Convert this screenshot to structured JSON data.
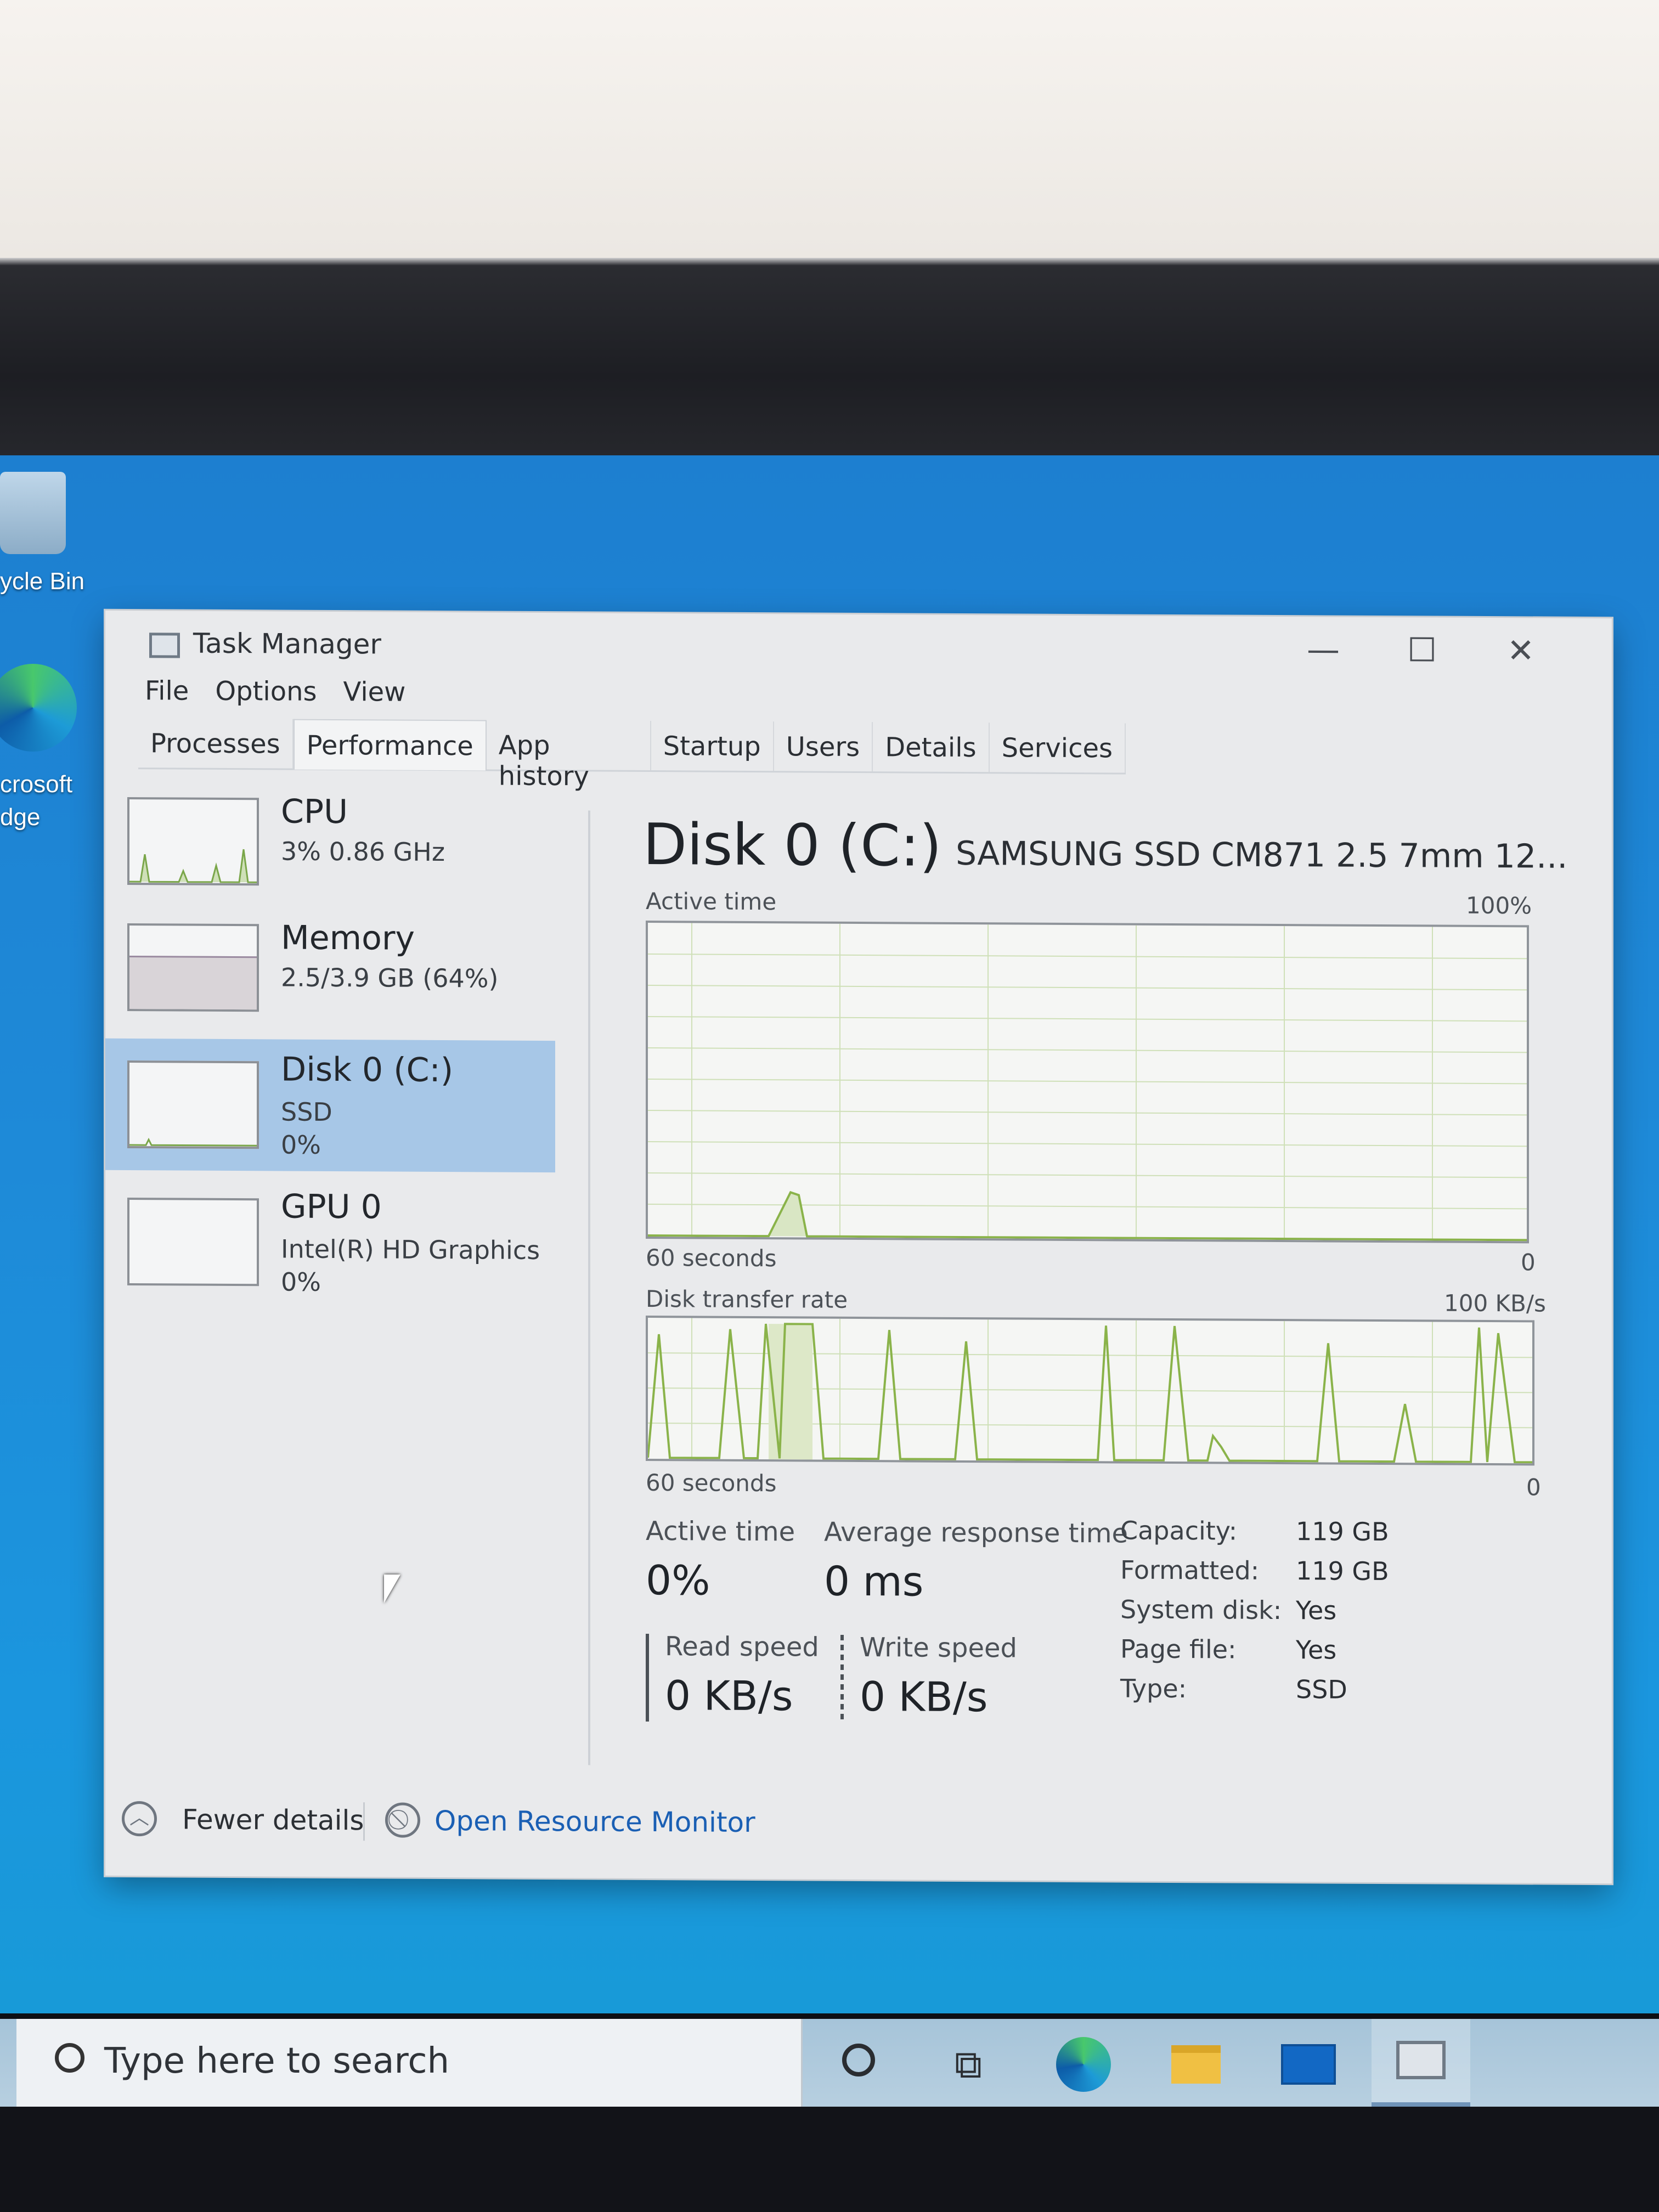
{
  "desktop": {
    "icons": [
      {
        "label": "ycle Bin"
      },
      {
        "label_line1": "crosoft",
        "label_line2": "dge"
      }
    ]
  },
  "window": {
    "title": "Task Manager",
    "controls": {
      "minimize": "—",
      "maximize": "☐",
      "close": "✕"
    }
  },
  "menu": [
    "File",
    "Options",
    "View"
  ],
  "tabs": [
    "Processes",
    "Performance",
    "App history",
    "Startup",
    "Users",
    "Details",
    "Services"
  ],
  "active_tab": "Performance",
  "sidebar": {
    "items": [
      {
        "name": "CPU",
        "sub1": "3% 0.86 GHz",
        "sub2": ""
      },
      {
        "name": "Memory",
        "sub1": "2.5/3.9 GB (64%)",
        "sub2": ""
      },
      {
        "name": "Disk 0 (C:)",
        "sub1": "SSD",
        "sub2": "0%"
      },
      {
        "name": "GPU 0",
        "sub1": "Intel(R) HD Graphics",
        "sub2": "0%"
      }
    ],
    "selected": "Disk 0 (C:)"
  },
  "disk": {
    "title": "Disk 0 (C:)",
    "model": "SAMSUNG SSD CM871 2.5 7mm 12...",
    "active_graph": {
      "label": "Active time",
      "max": "100%",
      "time": "60 seconds",
      "min": "0"
    },
    "transfer_graph": {
      "label": "Disk transfer rate",
      "max": "100 KB/s",
      "time": "60 seconds",
      "min": "0"
    },
    "stats": {
      "active_time_label": "Active time",
      "active_time": "0%",
      "avg_resp_label": "Average response time",
      "avg_resp": "0 ms",
      "read_label": "Read speed",
      "read": "0 KB/s",
      "write_label": "Write speed",
      "write": "0 KB/s"
    },
    "properties": [
      {
        "k": "Capacity:",
        "v": "119 GB"
      },
      {
        "k": "Formatted:",
        "v": "119 GB"
      },
      {
        "k": "System disk:",
        "v": "Yes"
      },
      {
        "k": "Page file:",
        "v": "Yes"
      },
      {
        "k": "Type:",
        "v": "SSD"
      }
    ]
  },
  "footer": {
    "fewer": "Fewer details",
    "resmon": "Open Resource Monitor"
  },
  "taskbar": {
    "search_placeholder": "Type here to search",
    "icons": [
      "cortana-icon",
      "task-view-icon",
      "edge-icon",
      "file-explorer-icon",
      "mail-icon",
      "task-manager-icon"
    ]
  },
  "colors": {
    "selected_item": "#a7c7e7",
    "graph_line": "#8ab34a",
    "link": "#1a5fb4"
  }
}
